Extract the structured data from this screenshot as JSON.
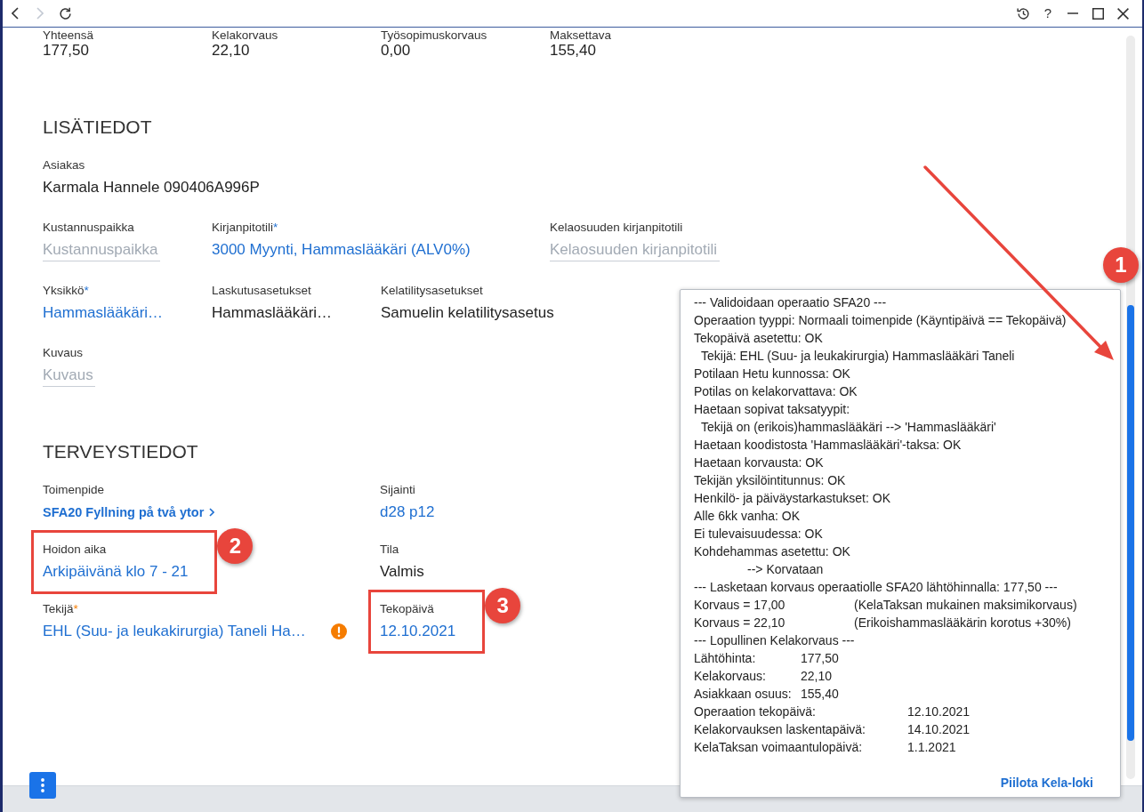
{
  "window": {
    "nav": [
      {
        "kind": "back",
        "disabled": false
      },
      {
        "kind": "forward",
        "disabled": true
      },
      {
        "kind": "refresh",
        "disabled": false
      }
    ],
    "help": "?"
  },
  "summary": [
    {
      "label": "Yhteensä",
      "kind": "text",
      "value": "177,50"
    },
    {
      "label": "Kelakorvaus",
      "kind": "text",
      "value": "22,10"
    },
    {
      "label": "Työsopimuskorvaus",
      "kind": "text",
      "value": "0,00"
    },
    {
      "label": "Maksettava",
      "kind": "text",
      "value": "155,40"
    }
  ],
  "sections": [
    {
      "heading": "LISÄTIEDOT",
      "kind": "grid",
      "rows": [
        [
          {
            "label": "Asiakas",
            "kind": "text",
            "value": "Karmala Hannele 090406A996P",
            "warning": false,
            "highlighted": false
          }
        ],
        [
          {
            "label": "Kustannuspaikka",
            "kind": "input",
            "placeholder": "Kustannuspaikka",
            "warning": false,
            "highlighted": false
          },
          {
            "label": "Kirjanpitotili",
            "mark": "*",
            "kind": "link",
            "value": "3000 Myynti, Hammaslääkäri (ALV0%)",
            "warning": false,
            "highlighted": false
          },
          {
            "label": "Kelaosuuden kirjanpitotili",
            "kind": "input",
            "placeholder": "Kelaosuuden kirjanpitotili",
            "warning": false,
            "highlighted": false
          }
        ],
        [
          {
            "label": "Yksikkö",
            "mark": "*",
            "kind": "link",
            "value": "Hammaslääkäri…",
            "warning": false,
            "highlighted": false
          },
          {
            "label": "Laskutusasetukset",
            "kind": "text",
            "value": "Hammaslääkäri…",
            "warning": false,
            "highlighted": false
          },
          {
            "label": "Kelatilitysasetukset",
            "kind": "text",
            "value": "Samuelin kelatilitysasetus",
            "warning": false,
            "highlighted": false
          }
        ],
        [
          {
            "label": "Kuvaus",
            "kind": "input",
            "placeholder": "Kuvaus",
            "warning": false,
            "highlighted": false
          }
        ]
      ]
    },
    {
      "heading": "TERVEYSTIEDOT",
      "kind": "split",
      "rows": [
        [
          {
            "label": "Toimenpide",
            "kind": "procedure",
            "value": "SFA20 Fyllning på två ytor",
            "warning": false,
            "highlighted": false
          },
          {
            "label": "Sijainti",
            "kind": "link",
            "value": "d28 p12",
            "warning": false,
            "highlighted": false
          }
        ],
        [
          {
            "label": "Hoidon aika",
            "kind": "link",
            "value": "Arkipäivänä klo 7 - 21",
            "warning": false,
            "highlighted": true,
            "callout": "2"
          },
          {
            "label": "Tila",
            "kind": "text",
            "value": "Valmis",
            "warning": false,
            "highlighted": false
          }
        ],
        [
          {
            "label": "Tekijä",
            "mark": "*",
            "kind": "link",
            "value": "EHL (Suu- ja leukakirurgia) Taneli Ha…",
            "warning": true,
            "highlighted": false
          },
          {
            "label": "Tekopäivä",
            "kind": "link",
            "value": "12.10.2021",
            "warning": false,
            "highlighted": true,
            "callout": "3"
          }
        ]
      ]
    }
  ],
  "kela_log": {
    "lines": [
      {
        "kind": "text",
        "text": "--- Validoidaan operaatio SFA20 ---"
      },
      {
        "kind": "text",
        "text": "Operaation tyyppi: Normaali toimenpide (Käyntipäivä == Tekopäivä)"
      },
      {
        "kind": "text",
        "text": "Tekopäivä asetettu: OK"
      },
      {
        "kind": "indent",
        "text": "Tekijä: EHL (Suu- ja leukakirurgia) Hammaslääkäri Taneli"
      },
      {
        "kind": "text",
        "text": "Potilaan Hetu kunnossa: OK"
      },
      {
        "kind": "text",
        "text": "Potilas on kelakorvattava: OK"
      },
      {
        "kind": "text",
        "text": "Haetaan sopivat taksatyypit:"
      },
      {
        "kind": "indent",
        "text": "Tekijä on (erikois)hammaslääkäri --> 'Hammaslääkäri'"
      },
      {
        "kind": "text",
        "text": "Haetaan koodistosta 'Hammaslääkäri'-taksa: OK"
      },
      {
        "kind": "text",
        "text": "Haetaan korvausta: OK"
      },
      {
        "kind": "text",
        "text": "Tekijän yksilöintitunnus: OK"
      },
      {
        "kind": "text",
        "text": "Henkilö- ja päiväystarkastukset: OK"
      },
      {
        "kind": "text",
        "text": "Alle 6kk vanha: OK"
      },
      {
        "kind": "text",
        "text": "Ei tulevaisuudessa: OK"
      },
      {
        "kind": "text",
        "text": "Kohdehammas asetettu: OK"
      },
      {
        "kind": "result",
        "text": "--> Korvataan"
      },
      {
        "kind": "text",
        "text": "--- Lasketaan korvaus operaatiolle SFA20 lähtöhinnalla: 177,50 ---"
      },
      {
        "kind": "note",
        "text": "Korvaus = 17,00",
        "value": "(KelaTaksan mukainen maksimikorvaus)"
      },
      {
        "kind": "note",
        "text": "Korvaus = 22,10",
        "value": "(Erikoishammaslääkärin korotus +30%)"
      },
      {
        "kind": "text",
        "text": "--- Lopullinen Kelakorvaus ---"
      },
      {
        "kind": "amount",
        "text": "Lähtöhinta:",
        "value": "177,50"
      },
      {
        "kind": "amount",
        "text": "Kelakorvaus:",
        "value": "22,10"
      },
      {
        "kind": "amount",
        "text": "Asiakkaan osuus:",
        "value": "155,40"
      },
      {
        "kind": "date",
        "text": "Operaation tekopäivä:",
        "value": "12.10.2021"
      },
      {
        "kind": "date",
        "text": "Kelakorvauksen laskentapäivä:",
        "value": "14.10.2021"
      },
      {
        "kind": "date",
        "text": "KelaTaksan voimaantulopäivä:",
        "value": "1.1.2021"
      }
    ],
    "hide_link": "Piilota Kela-loki"
  },
  "annotations": [
    {
      "kind": "arrow",
      "label": "1"
    }
  ]
}
